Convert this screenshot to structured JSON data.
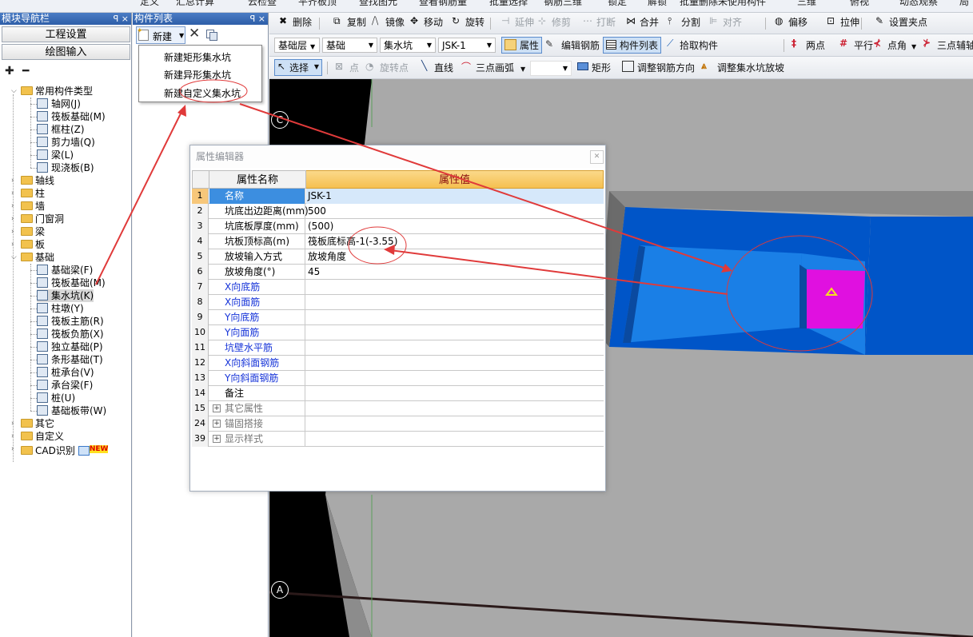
{
  "top_strip": [
    "定义",
    "汇总计算",
    "云检查",
    "平齐板顶",
    "查找图元",
    "查看钢筋量",
    "批量选择",
    "钢筋三维",
    "锁定",
    "解锁",
    "批量删除未使用构件",
    "三维",
    "俯视",
    "动态观察",
    "局"
  ],
  "nav_panel": {
    "title": "模块导航栏",
    "pin": "ꟼ ×",
    "btn_settings": "工程设置",
    "btn_draw": "绘图输入",
    "tree": {
      "common": "常用构件类型",
      "common_items": [
        "轴网(J)",
        "筏板基础(M)",
        "框柱(Z)",
        "剪力墙(Q)",
        "梁(L)",
        "现浇板(B)"
      ],
      "groups_top": [
        "轴线",
        "柱",
        "墙",
        "门窗洞",
        "梁",
        "板"
      ],
      "foundation": "基础",
      "foundation_items": [
        "基础梁(F)",
        "筏板基础(M)",
        "集水坑(K)",
        "柱墩(Y)",
        "筏板主筋(R)",
        "筏板负筋(X)",
        "独立基础(P)",
        "条形基础(T)",
        "桩承台(V)",
        "承台梁(F)",
        "桩(U)",
        "基础板带(W)"
      ],
      "groups_bottom": [
        "其它",
        "自定义",
        "CAD识别"
      ],
      "new_badge": "NEW"
    }
  },
  "comp_list": {
    "title": "构件列表",
    "pin": "ꟼ ×",
    "new_btn": "新建",
    "dropdown": [
      "新建矩形集水坑",
      "新建异形集水坑",
      "新建自定义集水坑"
    ]
  },
  "toolbar1": {
    "items": [
      "删除",
      "复制",
      "镜像",
      "移动",
      "旋转",
      "延伸",
      "修剪",
      "打断",
      "合并",
      "分割",
      "对齐",
      "偏移",
      "拉伸",
      "设置夹点"
    ]
  },
  "toolbar2": {
    "floor": "基础层",
    "category": "基础",
    "type": "集水坑",
    "name": "JSK-1",
    "buttons": [
      "属性",
      "编辑钢筋",
      "构件列表",
      "拾取构件",
      "两点",
      "平行",
      "点角",
      "三点辅轴"
    ]
  },
  "toolbar3": {
    "items": [
      "选择",
      "点",
      "旋转点",
      "直线",
      "三点画弧",
      "矩形",
      "调整钢筋方向",
      "调整集水坑放坡"
    ]
  },
  "canvas": {
    "axis_top": "C",
    "axis_bottom": "A"
  },
  "prop_editor": {
    "title": "属性编辑器",
    "col_name": "属性名称",
    "col_value": "属性值",
    "rows": [
      {
        "n": "1",
        "name": "名称",
        "value": "JSK-1"
      },
      {
        "n": "2",
        "name": "坑底出边距离(mm)",
        "value": "500"
      },
      {
        "n": "3",
        "name": "坑底板厚度(mm)",
        "value": "(500)"
      },
      {
        "n": "4",
        "name": "坑板顶标高(m)",
        "value": "筏板底标高-1(-3.55)"
      },
      {
        "n": "5",
        "name": "放坡输入方式",
        "value": "放坡角度"
      },
      {
        "n": "6",
        "name": "放坡角度(°)",
        "value": "45"
      },
      {
        "n": "7",
        "name": "X向底筋",
        "value": ""
      },
      {
        "n": "8",
        "name": "X向面筋",
        "value": ""
      },
      {
        "n": "9",
        "name": "Y向底筋",
        "value": ""
      },
      {
        "n": "10",
        "name": "Y向面筋",
        "value": ""
      },
      {
        "n": "11",
        "name": "坑壁水平筋",
        "value": ""
      },
      {
        "n": "12",
        "name": "X向斜面钢筋",
        "value": ""
      },
      {
        "n": "13",
        "name": "Y向斜面钢筋",
        "value": ""
      },
      {
        "n": "14",
        "name": "备注",
        "value": ""
      },
      {
        "n": "15",
        "name": "其它属性",
        "value": ""
      },
      {
        "n": "24",
        "name": "锚固搭接",
        "value": ""
      },
      {
        "n": "39",
        "name": "显示样式",
        "value": ""
      }
    ]
  },
  "colors": {
    "pit_dark": "#0055c8",
    "pit_light": "#1a7fe6",
    "magenta": "#e010e0",
    "slab": "#a9a9a9",
    "annotation": "#e03a3a"
  }
}
